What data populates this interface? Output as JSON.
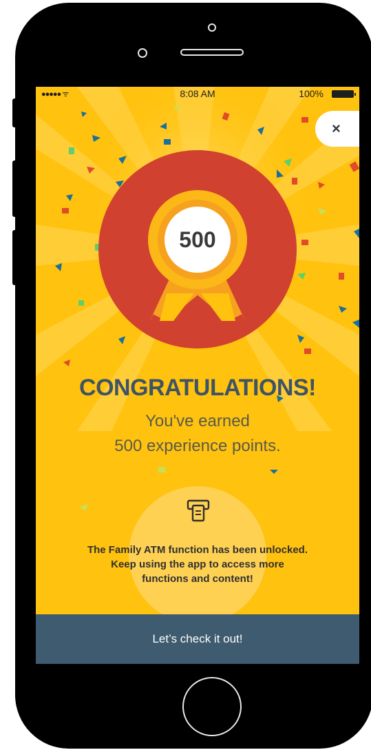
{
  "status_bar": {
    "signal": "●●●●● ᯤ",
    "time": "8:08 AM",
    "battery": "100%"
  },
  "close_button": {
    "label": "×"
  },
  "badge": {
    "points": "500"
  },
  "headline": "CONGRATULATIONS!",
  "subtitle_line1": "You've earned",
  "subtitle_line2": "500 experience points.",
  "unlock": {
    "icon": "atm-icon",
    "line1": "The Family ATM function has been unlocked.",
    "line2": "Keep using the app to access more",
    "line3": "functions and content!"
  },
  "cta_label": "Let’s check it out!",
  "colors": {
    "background": "#ffc20e",
    "badge_red": "#d0412f",
    "ribbon": "#f6a21e",
    "title": "#3e5366",
    "cta": "#3e5b6f"
  }
}
